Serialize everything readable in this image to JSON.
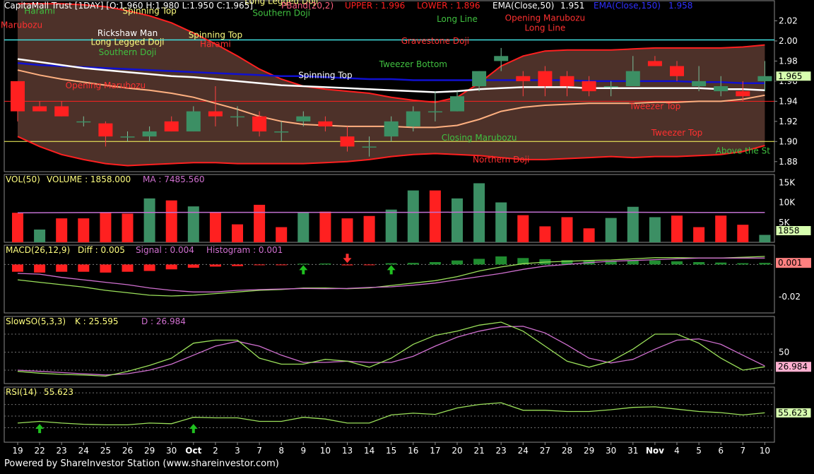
{
  "footer": "Powered by ShareInvestor Station (www.shareinvestor.com)",
  "colors": {
    "up": "#3c8f64",
    "down": "#ff2020",
    "frame": "#8a8a8a",
    "ema50": "#ffffff",
    "ema150": "#1010d0",
    "bb": "#ff2020",
    "bbmid": "#ffb080",
    "volma": "#c070d0",
    "macdDiff": "#9be05a",
    "macdSignal": "#d070d0",
    "soK": "#9be05a",
    "soD": "#d070d0",
    "rsi": "#9be05a",
    "text_hdr": "#ffff80"
  },
  "x_labels": [
    "19",
    "22",
    "23",
    "24",
    "25",
    "26",
    "29",
    "30",
    "Oct",
    "2",
    "3",
    "7",
    "8",
    "9",
    "10",
    "13",
    "14",
    "15",
    "16",
    "17",
    "20",
    "21",
    "23",
    "24",
    "27",
    "28",
    "29",
    "30",
    "31",
    "Nov",
    "4",
    "5",
    "6",
    "7",
    "10"
  ],
  "price_header": {
    "title": "CapitaMall Trust [1DAY] [O:1.960 H:1.980 L:1.950 C:1.965]",
    "pband": "PBand(20,2)",
    "upper": "UPPER : 1.996",
    "lower": "LOWER : 1.896",
    "ema50": "EMA(Close,50)",
    "ema50_val": "1.951",
    "ema150": "EMA(Close,150)",
    "ema150_val": "1.958"
  },
  "vol_header": {
    "label": "VOL(50)",
    "volume": "VOLUME : 1858.000",
    "ma": "MA : 7485.560"
  },
  "macd_header": {
    "label": "MACD(26,12,9)",
    "diff": "Diff : 0.005",
    "signal": "Signal : 0.004",
    "hist": "Histogram : 0.001"
  },
  "so_header": {
    "label": "SlowSO(5,3,3)",
    "k": "K : 25.595",
    "d": "D : 26.984"
  },
  "rsi_header": {
    "label": "RSI(14)",
    "value": "55.623"
  },
  "chart_data": [
    {
      "type": "candlestick",
      "ylim": [
        1.87,
        2.04
      ],
      "y_ticks": [
        "1.88",
        "1.90",
        "1.92",
        "1.94",
        "1.96",
        "1.98",
        "2.00",
        "2.02"
      ],
      "last_value_label": "1.965",
      "candles": [
        [
          1.96,
          1.96,
          1.92,
          1.93
        ],
        [
          1.935,
          1.94,
          1.93,
          1.93
        ],
        [
          1.935,
          1.94,
          1.925,
          1.925
        ],
        [
          1.92,
          1.925,
          1.915,
          1.92
        ],
        [
          1.918,
          1.92,
          1.895,
          1.905
        ],
        [
          1.905,
          1.91,
          1.9,
          1.905
        ],
        [
          1.905,
          1.915,
          1.9,
          1.91
        ],
        [
          1.92,
          1.925,
          1.91,
          1.91
        ],
        [
          1.91,
          1.935,
          1.91,
          1.93
        ],
        [
          1.93,
          1.955,
          1.915,
          1.925
        ],
        [
          1.925,
          1.935,
          1.915,
          1.925
        ],
        [
          1.925,
          1.93,
          1.905,
          1.91
        ],
        [
          1.91,
          1.92,
          1.9,
          1.91
        ],
        [
          1.92,
          1.93,
          1.915,
          1.925
        ],
        [
          1.92,
          1.925,
          1.91,
          1.915
        ],
        [
          1.905,
          1.915,
          1.89,
          1.895
        ],
        [
          1.895,
          1.905,
          1.885,
          1.895
        ],
        [
          1.905,
          1.925,
          1.9,
          1.92
        ],
        [
          1.915,
          1.935,
          1.91,
          1.93
        ],
        [
          1.93,
          1.95,
          1.92,
          1.93
        ],
        [
          1.93,
          1.95,
          1.93,
          1.945
        ],
        [
          1.955,
          1.97,
          1.95,
          1.97
        ],
        [
          1.98,
          1.993,
          1.97,
          1.985
        ],
        [
          1.965,
          1.97,
          1.945,
          1.96
        ],
        [
          1.97,
          1.975,
          1.945,
          1.955
        ],
        [
          1.965,
          1.97,
          1.945,
          1.955
        ],
        [
          1.96,
          1.965,
          1.945,
          1.95
        ],
        [
          1.955,
          1.96,
          1.945,
          1.955
        ],
        [
          1.955,
          1.985,
          1.955,
          1.97
        ],
        [
          1.98,
          1.985,
          1.975,
          1.975
        ],
        [
          1.975,
          1.98,
          1.96,
          1.965
        ],
        [
          1.955,
          1.975,
          1.95,
          1.96
        ],
        [
          1.95,
          1.965,
          1.945,
          1.955
        ],
        [
          1.95,
          1.96,
          1.94,
          1.945
        ],
        [
          1.96,
          1.98,
          1.95,
          1.965
        ]
      ],
      "ema50": [
        1.982,
        1.979,
        1.976,
        1.973,
        1.971,
        1.969,
        1.967,
        1.965,
        1.964,
        1.962,
        1.96,
        1.958,
        1.956,
        1.955,
        1.954,
        1.953,
        1.952,
        1.951,
        1.95,
        1.949,
        1.95,
        1.952,
        1.953,
        1.954,
        1.954,
        1.954,
        1.953,
        1.953,
        1.953,
        1.953,
        1.953,
        1.953,
        1.952,
        1.952,
        1.951
      ],
      "ema150": [
        1.978,
        1.976,
        1.975,
        1.974,
        1.973,
        1.972,
        1.971,
        1.97,
        1.969,
        1.968,
        1.967,
        1.966,
        1.965,
        1.965,
        1.964,
        1.963,
        1.962,
        1.962,
        1.961,
        1.961,
        1.961,
        1.961,
        1.961,
        1.961,
        1.961,
        1.961,
        1.96,
        1.96,
        1.96,
        1.96,
        1.96,
        1.959,
        1.959,
        1.958,
        1.958
      ],
      "bb_upper": [
        2.037,
        2.037,
        2.037,
        2.036,
        2.034,
        2.03,
        2.025,
        2.018,
        2.008,
        1.997,
        1.985,
        1.972,
        1.962,
        1.955,
        1.952,
        1.95,
        1.948,
        1.944,
        1.941,
        1.939,
        1.944,
        1.958,
        1.975,
        1.985,
        1.99,
        1.991,
        1.991,
        1.991,
        1.992,
        1.993,
        1.993,
        1.993,
        1.993,
        1.994,
        1.996
      ],
      "bb_lower": [
        1.905,
        1.895,
        1.887,
        1.882,
        1.878,
        1.876,
        1.877,
        1.878,
        1.879,
        1.879,
        1.878,
        1.878,
        1.878,
        1.878,
        1.879,
        1.88,
        1.882,
        1.885,
        1.887,
        1.888,
        1.887,
        1.886,
        1.884,
        1.882,
        1.882,
        1.883,
        1.884,
        1.885,
        1.884,
        1.885,
        1.885,
        1.886,
        1.887,
        1.89,
        1.896
      ],
      "bb_mid": [
        1.971,
        1.966,
        1.962,
        1.959,
        1.956,
        1.953,
        1.951,
        1.948,
        1.944,
        1.938,
        1.932,
        1.925,
        1.92,
        1.917,
        1.916,
        1.915,
        1.915,
        1.915,
        1.914,
        1.914,
        1.916,
        1.922,
        1.93,
        1.934,
        1.936,
        1.937,
        1.938,
        1.938,
        1.938,
        1.939,
        1.939,
        1.94,
        1.94,
        1.942,
        1.946
      ],
      "hlines": [
        1.94,
        1.9,
        2.001
      ],
      "annotations": [
        {
          "text": "Harami",
          "i": 1,
          "y": 2.027,
          "color": "#40c040"
        },
        {
          "text": "a Marubozu",
          "i": 0,
          "y": 2.013,
          "color": "#ff3030"
        },
        {
          "text": "Spinning Top",
          "i": 6,
          "y": 2.027,
          "color": "#ffff80"
        },
        {
          "text": "Long Legged Doji",
          "i": 12,
          "y": 2.037,
          "color": "#ffff80"
        },
        {
          "text": "Southern Doji",
          "i": 12,
          "y": 2.025,
          "color": "#40c040"
        },
        {
          "text": "Rickshaw Man",
          "i": 5,
          "y": 2.005,
          "color": "#ffffff"
        },
        {
          "text": "Long Legged Doji",
          "i": 5,
          "y": 1.996,
          "color": "#ffff80"
        },
        {
          "text": "Southern Doji",
          "i": 5,
          "y": 1.986,
          "color": "#40c040"
        },
        {
          "text": "Spinning Top",
          "i": 9,
          "y": 2.003,
          "color": "#ffff80"
        },
        {
          "text": "Harami",
          "i": 9,
          "y": 1.994,
          "color": "#ff3030"
        },
        {
          "text": "Long Line",
          "i": 20,
          "y": 2.019,
          "color": "#40c040"
        },
        {
          "text": "Opening Marubozu",
          "i": 24,
          "y": 2.02,
          "color": "#ff3030"
        },
        {
          "text": "Long Line",
          "i": 24,
          "y": 2.01,
          "color": "#ff3030"
        },
        {
          "text": "Gravestone Doji",
          "i": 19,
          "y": 1.997,
          "color": "#ff3030"
        },
        {
          "text": "Tweezer Bottom",
          "i": 18,
          "y": 1.974,
          "color": "#40c040"
        },
        {
          "text": "Opening Marubozu",
          "i": 4,
          "y": 1.953,
          "color": "#ff3030"
        },
        {
          "text": "Spinning Top",
          "i": 14,
          "y": 1.963,
          "color": "#ffffff"
        },
        {
          "text": "Tweezer Top",
          "i": 29,
          "y": 1.932,
          "color": "#ff3030"
        },
        {
          "text": "Tweezer Top",
          "i": 30,
          "y": 1.906,
          "color": "#ff3030"
        },
        {
          "text": "Closing Marubozu",
          "i": 21,
          "y": 1.901,
          "color": "#40c040"
        },
        {
          "text": "Northern Doji",
          "i": 22,
          "y": 1.879,
          "color": "#ff3030"
        },
        {
          "text": "Above the St",
          "i": 33,
          "y": 1.888,
          "color": "#40c040"
        }
      ]
    },
    {
      "type": "bar",
      "name": "Volume",
      "ylim": [
        0,
        17000
      ],
      "y_ticks": [
        "5K",
        "10K",
        "15K"
      ],
      "values": [
        7400,
        3200,
        6000,
        6000,
        7500,
        7200,
        11000,
        10500,
        9000,
        7600,
        4500,
        9400,
        3800,
        7500,
        7700,
        6000,
        6600,
        8200,
        13000,
        13000,
        11000,
        14800,
        10000,
        6800,
        4000,
        6300,
        3500,
        6100,
        8900,
        6300,
        6700,
        3800,
        6700,
        4400,
        1858
      ],
      "directions": [
        "down",
        "up",
        "down",
        "down",
        "down",
        "down",
        "up",
        "down",
        "up",
        "down",
        "down",
        "down",
        "down",
        "up",
        "down",
        "down",
        "down",
        "up",
        "up",
        "down",
        "up",
        "up",
        "up",
        "down",
        "down",
        "down",
        "down",
        "up",
        "up",
        "up",
        "down",
        "down",
        "down",
        "down",
        "up"
      ],
      "ma": [
        7400,
        7420,
        7440,
        7450,
        7460,
        7470,
        7480,
        7490,
        7500,
        7500,
        7510,
        7510,
        7500,
        7500,
        7500,
        7500,
        7500,
        7500,
        7510,
        7520,
        7540,
        7560,
        7570,
        7570,
        7560,
        7550,
        7540,
        7530,
        7520,
        7510,
        7500,
        7495,
        7490,
        7488,
        7485.56
      ],
      "last_value_label": "1858"
    },
    {
      "type": "macd",
      "ylim": [
        -0.03,
        0.012
      ],
      "y_ticks": [
        "-0.02"
      ],
      "histogram": [
        -0.0045,
        -0.005,
        -0.0045,
        -0.0045,
        -0.005,
        -0.0045,
        -0.004,
        -0.003,
        -0.002,
        -0.0013,
        -0.001,
        -0.0004,
        -0.0002,
        0.0005,
        0.0006,
        -0.0005,
        -0.0004,
        0.0008,
        0.001,
        0.0015,
        0.0025,
        0.0035,
        0.005,
        0.004,
        0.0033,
        0.0027,
        0.0025,
        0.0022,
        0.0025,
        0.0025,
        0.002,
        0.0015,
        0.0012,
        0.0008,
        0.001
      ],
      "diff": [
        -0.0095,
        -0.011,
        -0.0125,
        -0.014,
        -0.016,
        -0.0175,
        -0.019,
        -0.0195,
        -0.019,
        -0.018,
        -0.017,
        -0.016,
        -0.0155,
        -0.0145,
        -0.0145,
        -0.015,
        -0.0145,
        -0.013,
        -0.0115,
        -0.01,
        -0.0075,
        -0.004,
        -0.0015,
        0.0005,
        0.0015,
        0.002,
        0.0025,
        0.0028,
        0.0035,
        0.0042,
        0.0043,
        0.004,
        0.004,
        0.0045,
        0.005
      ],
      "signal": [
        -0.0055,
        -0.006,
        -0.008,
        -0.0095,
        -0.011,
        -0.0125,
        -0.0145,
        -0.016,
        -0.017,
        -0.017,
        -0.016,
        -0.0155,
        -0.0152,
        -0.0148,
        -0.015,
        -0.0148,
        -0.0142,
        -0.0138,
        -0.0128,
        -0.0115,
        -0.0095,
        -0.0075,
        -0.0055,
        -0.003,
        -0.001,
        0.0,
        0.0012,
        0.002,
        0.0025,
        0.003,
        0.0035,
        0.004,
        0.004,
        0.004,
        0.004
      ],
      "arrows_up": [
        13,
        17
      ],
      "arrows_down": [
        15
      ],
      "last_value_label": "0.001"
    },
    {
      "type": "line",
      "name": "Slow Stochastic",
      "ylim": [
        0,
        100
      ],
      "y_ticks": [
        "50"
      ],
      "k": [
        18,
        15,
        13,
        12,
        10,
        18,
        28,
        40,
        65,
        70,
        70,
        40,
        30,
        30,
        38,
        35,
        25,
        40,
        63,
        78,
        85,
        95,
        100,
        85,
        60,
        35,
        25,
        35,
        55,
        80,
        80,
        65,
        40,
        20,
        25.595
      ],
      "d": [
        20,
        18,
        16,
        14,
        12,
        14,
        20,
        30,
        45,
        60,
        68,
        60,
        45,
        33,
        33,
        35,
        33,
        33,
        43,
        60,
        75,
        85,
        92,
        93,
        82,
        62,
        40,
        32,
        38,
        55,
        70,
        72,
        63,
        45,
        26.984
      ],
      "last_value_label": "26.984"
    },
    {
      "type": "line",
      "name": "RSI",
      "ylim": [
        0,
        100
      ],
      "last_value_label": "55.623",
      "values": [
        38,
        41,
        38,
        36,
        35,
        35,
        38,
        37,
        48,
        47,
        47,
        41,
        41,
        48,
        45,
        38,
        38,
        52,
        55,
        53,
        64,
        70,
        73,
        60,
        60,
        58,
        58,
        61,
        65,
        66,
        62,
        58,
        56,
        52,
        55.623
      ],
      "arrows_up": [
        1,
        8
      ]
    }
  ]
}
